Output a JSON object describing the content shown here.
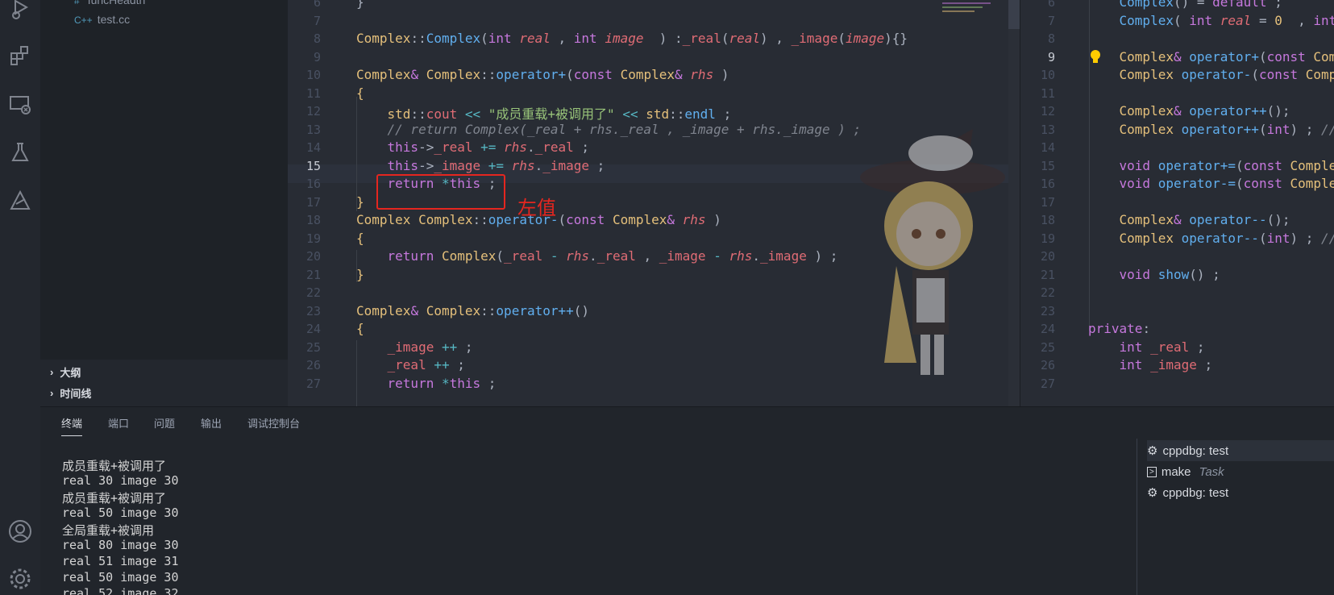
{
  "explorer": {
    "files": [
      "funcHeadth",
      "test.cc"
    ],
    "sections": [
      "大纲",
      "时间线"
    ]
  },
  "left_editor": {
    "lines": [
      {
        "n": "6",
        "html": "<span>}</span>"
      },
      {
        "n": "7",
        "html": ""
      },
      {
        "n": "8",
        "html": "<span class='ty'>Complex</span>::<span class='fn'>Complex</span>(<span class='kw'>int</span> <span class='pm'>real</span> , <span class='kw'>int</span> <span class='pm'>image</span>  ) :<span class='mb'>_real</span>(<span class='pm'>real</span>) , <span class='mb'>_image</span>(<span class='pm'>image</span>){}"
      },
      {
        "n": "9",
        "html": ""
      },
      {
        "n": "10",
        "html": "<span class='ty'>Complex</span><span class='kw'>&amp;</span> <span class='ty'>Complex</span>::<span class='fn'>operator+</span>(<span class='kw'>const</span> <span class='ty'>Complex</span><span class='kw'>&amp;</span> <span class='pm'>rhs</span> )"
      },
      {
        "n": "11",
        "html": "<span style='color:#e5c07b'>{</span>"
      },
      {
        "n": "12",
        "html": "    <span class='ty'>std</span>::<span class='mb'>cout</span> <span class='op'>&lt;&lt;</span> <span class='st'>\"成员重载+被调用了\"</span> <span class='op'>&lt;&lt;</span> <span class='ty'>std</span>::<span class='fn'>endl</span> ;"
      },
      {
        "n": "13",
        "html": "    <span class='cm'>// return Complex(_real + rhs._real , _image + rhs._image ) ;</span>"
      },
      {
        "n": "14",
        "html": "    <span class='kw'>this</span>-><span class='mb'>_real</span> <span class='op'>+=</span> <span class='pm'>rhs</span>.<span class='mb'>_real</span> ;"
      },
      {
        "n": "15",
        "html": "    <span class='kw'>this</span>-><span class='mb'>_image</span> <span class='op'>+=</span> <span class='pm'>rhs</span>.<span class='mb'>_image</span> ;"
      },
      {
        "n": "16",
        "html": "    <span class='kw'>return</span> <span class='op'>*</span><span class='kw'>this</span> ;"
      },
      {
        "n": "17",
        "html": "<span style='color:#e5c07b'>}</span>"
      },
      {
        "n": "18",
        "html": "<span class='ty'>Complex</span> <span class='ty'>Complex</span>::<span class='fn'>operator-</span>(<span class='kw'>const</span> <span class='ty'>Complex</span><span class='kw'>&amp;</span> <span class='pm'>rhs</span> )"
      },
      {
        "n": "19",
        "html": "<span style='color:#e5c07b'>{</span>"
      },
      {
        "n": "20",
        "html": "    <span class='kw'>return</span> <span class='ty'>Complex</span>(<span class='mb'>_real</span> <span class='op'>-</span> <span class='pm'>rhs</span>.<span class='mb'>_real</span> , <span class='mb'>_image</span> <span class='op'>-</span> <span class='pm'>rhs</span>.<span class='mb'>_image</span> ) ;"
      },
      {
        "n": "21",
        "html": "<span style='color:#e5c07b'>}</span>"
      },
      {
        "n": "22",
        "html": ""
      },
      {
        "n": "23",
        "html": "<span class='ty'>Complex</span><span class='kw'>&amp;</span> <span class='ty'>Complex</span>::<span class='fn'>operator++</span>()"
      },
      {
        "n": "24",
        "html": "<span style='color:#e5c07b'>{</span>"
      },
      {
        "n": "25",
        "html": "    <span class='mb'>_image</span> <span class='op'>++</span> ;"
      },
      {
        "n": "26",
        "html": "    <span class='mb'>_real</span> <span class='op'>++</span> ;"
      },
      {
        "n": "27",
        "html": "    <span class='kw'>return</span> <span class='op'>*</span><span class='kw'>this</span> ;"
      }
    ],
    "active_line": "15",
    "annotation": "左值"
  },
  "right_editor": {
    "lines": [
      {
        "n": "6",
        "html": "    <span class='fn'>Complex</span>() = <span class='kw'>default</span> ;"
      },
      {
        "n": "7",
        "html": "    <span class='fn'>Complex</span>( <span class='kw'>int</span> <span class='pm'>real</span> = <span class='ty'>0</span>  , <span class='kw'>int</span>"
      },
      {
        "n": "8",
        "html": ""
      },
      {
        "n": "9",
        "html": "    <span class='ty'>Complex</span><span class='kw'>&amp;</span> <span class='fn'>operator+</span>(<span class='kw'>const</span> <span class='ty'>Com</span>"
      },
      {
        "n": "10",
        "html": "    <span class='ty'>Complex</span> <span class='fn'>operator-</span>(<span class='kw'>const</span> <span class='ty'>Comp</span>"
      },
      {
        "n": "11",
        "html": ""
      },
      {
        "n": "12",
        "html": "    <span class='ty'>Complex</span><span class='kw'>&amp;</span> <span class='fn'>operator++</span>();"
      },
      {
        "n": "13",
        "html": "    <span class='ty'>Complex</span> <span class='fn'>operator++</span>(<span class='kw'>int</span>) ; <span class='cm'>//</span>"
      },
      {
        "n": "14",
        "html": ""
      },
      {
        "n": "15",
        "html": "    <span class='kw'>void</span> <span class='fn'>operator+=</span>(<span class='kw'>const</span> <span class='ty'>Comple</span>"
      },
      {
        "n": "16",
        "html": "    <span class='kw'>void</span> <span class='fn'>operator-=</span>(<span class='kw'>const</span> <span class='ty'>Comple</span>"
      },
      {
        "n": "17",
        "html": ""
      },
      {
        "n": "18",
        "html": "    <span class='ty'>Complex</span><span class='kw'>&amp;</span> <span class='fn'>operator--</span>();"
      },
      {
        "n": "19",
        "html": "    <span class='ty'>Complex</span> <span class='fn'>operator--</span>(<span class='kw'>int</span>) ; <span class='cm'>//</span>"
      },
      {
        "n": "20",
        "html": ""
      },
      {
        "n": "21",
        "html": "    <span class='kw'>void</span> <span class='fn'>show</span>() ;"
      },
      {
        "n": "22",
        "html": ""
      },
      {
        "n": "23",
        "html": ""
      },
      {
        "n": "24",
        "html": "<span class='kw'>private</span>:"
      },
      {
        "n": "25",
        "html": "    <span class='kw'>int</span> <span class='mb'>_real</span> ;"
      },
      {
        "n": "26",
        "html": "    <span class='kw'>int</span> <span class='mb'>_image</span> ;"
      },
      {
        "n": "27",
        "html": ""
      }
    ],
    "active_line": "9"
  },
  "panel": {
    "tabs": [
      "终端",
      "端口",
      "问题",
      "输出",
      "调试控制台"
    ],
    "terminal_lines": [
      "成员重载+被调用了",
      "real 30 image 30",
      "成员重载+被调用了",
      "real 50 image 30",
      "全局重载+被调用",
      "real 80 image 30",
      "real 51 image 31",
      "real 50 image 30",
      "real 52 image 32"
    ],
    "terminals": [
      {
        "label": "cppdbg: test",
        "task": "",
        "icon": "debug-icon"
      },
      {
        "label": "make",
        "task": "Task",
        "icon": "terminal-icon"
      },
      {
        "label": "cppdbg: test",
        "task": "",
        "icon": "debug-icon"
      }
    ]
  },
  "colors": {
    "accent_red": "#e5261f",
    "bg": "#282c34"
  }
}
